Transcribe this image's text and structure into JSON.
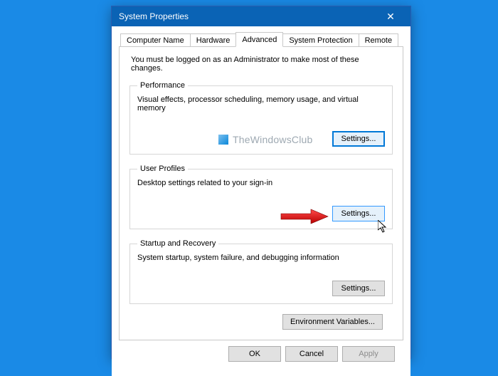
{
  "window": {
    "title": "System Properties",
    "close_glyph": "✕"
  },
  "tabs": {
    "computer_name": "Computer Name",
    "hardware": "Hardware",
    "advanced": "Advanced",
    "system_protection": "System Protection",
    "remote": "Remote"
  },
  "intro": "You must be logged on as an Administrator to make most of these changes.",
  "groups": {
    "performance": {
      "title": "Performance",
      "desc": "Visual effects, processor scheduling, memory usage, and virtual memory",
      "button": "Settings..."
    },
    "user_profiles": {
      "title": "User Profiles",
      "desc": "Desktop settings related to your sign-in",
      "button": "Settings..."
    },
    "startup": {
      "title": "Startup and Recovery",
      "desc": "System startup, system failure, and debugging information",
      "button": "Settings..."
    }
  },
  "env_button": "Environment Variables...",
  "dlg": {
    "ok": "OK",
    "cancel": "Cancel",
    "apply": "Apply"
  },
  "watermark": "TheWindowsClub"
}
